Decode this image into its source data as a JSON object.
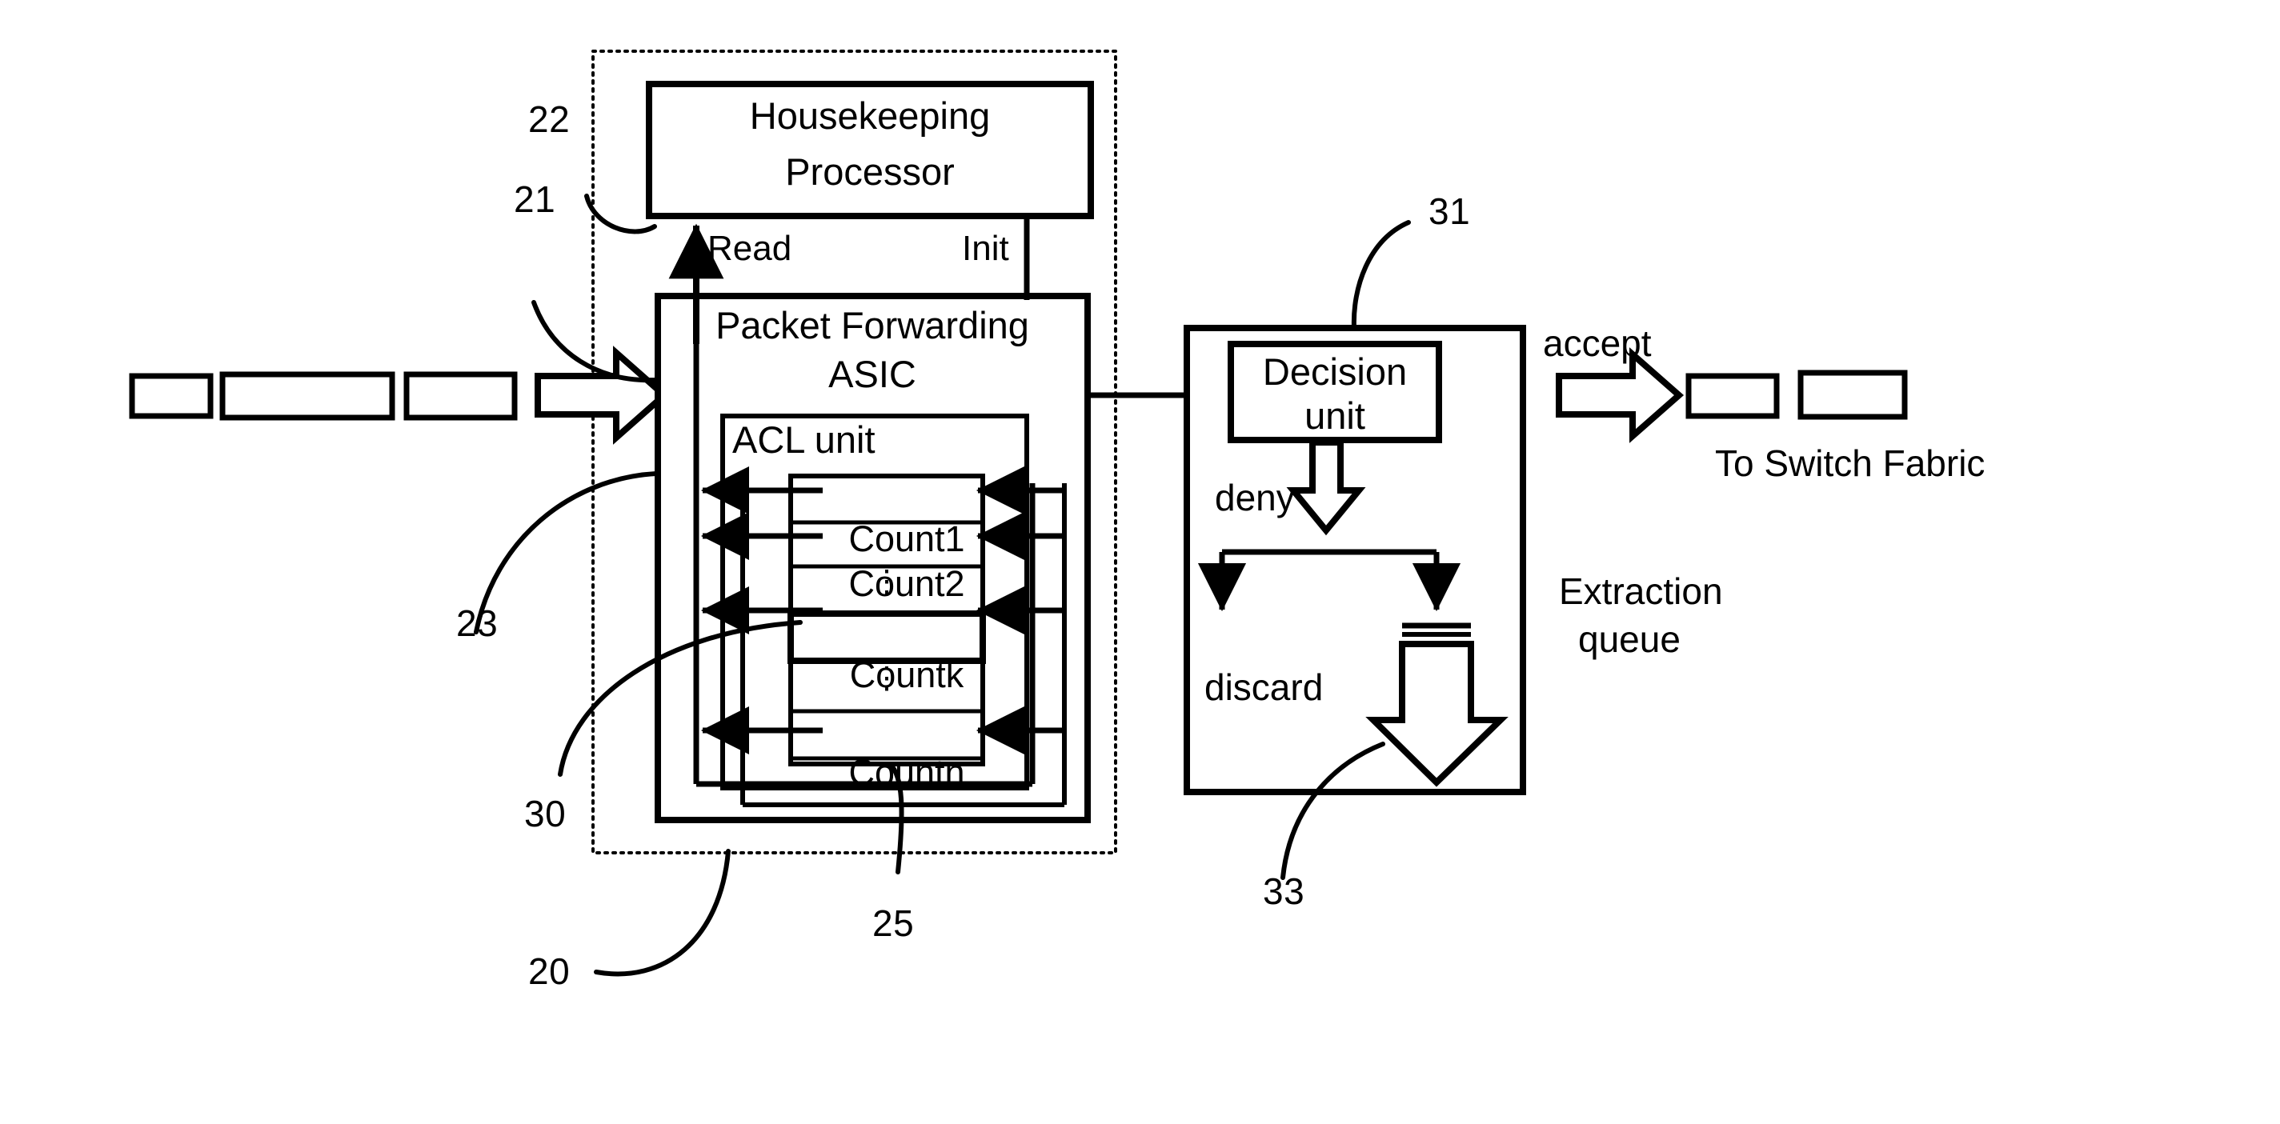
{
  "figure": {
    "type": "patent-block-diagram",
    "subject": "Packet forwarding ASIC with ACL counters, housekeeping processor and decision unit"
  },
  "blocks": {
    "housekeeping": {
      "line1": "Housekeeping",
      "line2": "Processor"
    },
    "asic": {
      "line1": "Packet Forwarding",
      "line2": "ASIC"
    },
    "acl": {
      "label": "ACL unit"
    },
    "decision": {
      "line1": "Decision",
      "line2": "unit"
    }
  },
  "counters": {
    "rows": [
      {
        "label": "Count",
        "index": "1",
        "emphasis": false,
        "blank": false
      },
      {
        "label": "Count",
        "index": "2",
        "emphasis": false,
        "blank": false
      },
      {
        "label": "",
        "index": "",
        "emphasis": false,
        "blank": true
      },
      {
        "label": "Count",
        "index": "k",
        "emphasis": true,
        "blank": false
      },
      {
        "label": "",
        "index": "",
        "emphasis": false,
        "blank": true
      },
      {
        "label": "Count",
        "index": "n",
        "emphasis": false,
        "blank": false
      }
    ],
    "ellipsis_glyph": "⋮"
  },
  "signals": {
    "read": "Read",
    "init": "Init",
    "accept": "accept",
    "deny": "deny",
    "discard": "discard"
  },
  "annotations": {
    "extraction_queue_line1": "Extraction",
    "extraction_queue_line2": "queue",
    "to_switch_fabric": "To Switch Fabric"
  },
  "reference_numerals": {
    "n20": "20",
    "n21": "21",
    "n22": "22",
    "n23": "23",
    "n25": "25",
    "n30": "30",
    "n31": "31",
    "n33": "33"
  },
  "colors": {
    "ink": "#000000",
    "paper": "#ffffff"
  }
}
